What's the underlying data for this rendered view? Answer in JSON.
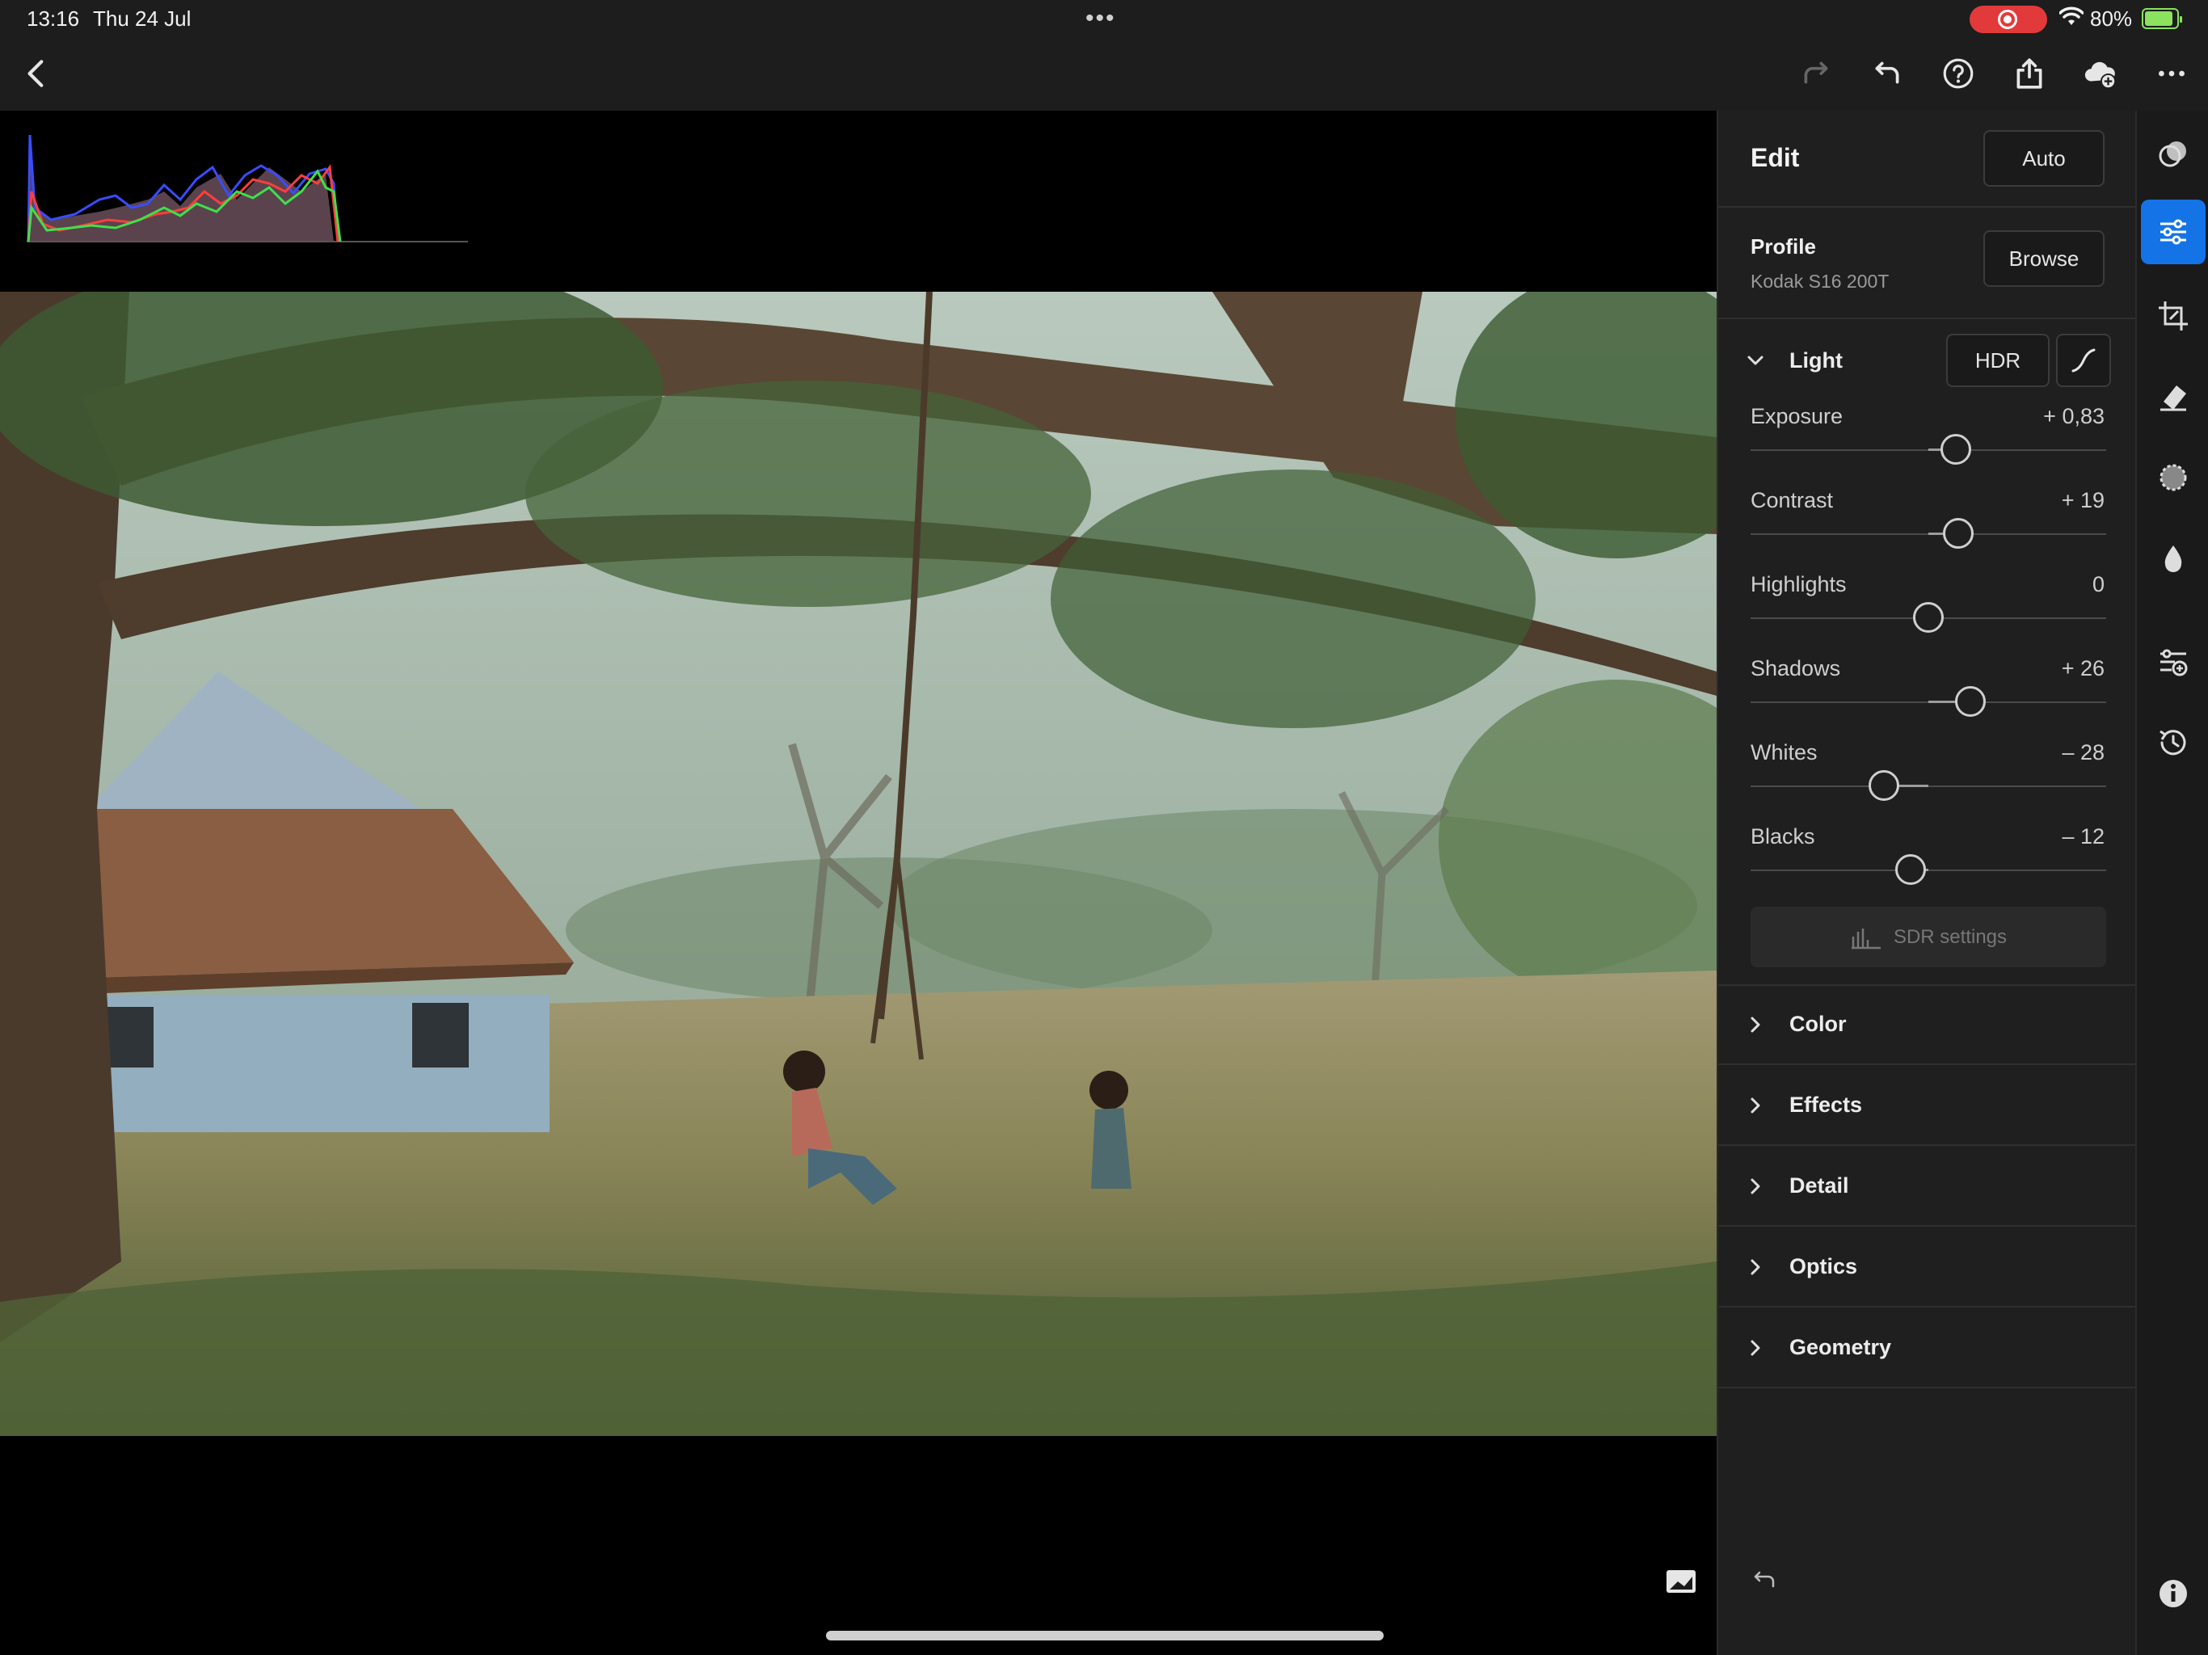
{
  "status_bar": {
    "time": "13:16",
    "date": "Thu 24 Jul",
    "battery": "80%",
    "center_dots": "•••"
  },
  "toolbar": {
    "icons": [
      "back-icon",
      "redo-icon",
      "undo-icon",
      "help-icon",
      "share-icon",
      "cloud-add-icon",
      "more-icon"
    ]
  },
  "panel": {
    "title": "Edit",
    "auto_label": "Auto",
    "profile": {
      "label": "Profile",
      "value": "Kodak S16 200T",
      "browse_label": "Browse"
    },
    "light": {
      "label": "Light",
      "hdr_label": "HDR",
      "sliders": [
        {
          "label": "Exposure",
          "value": "+ 0,83",
          "level": 0.578
        },
        {
          "label": "Contrast",
          "value": "+ 19",
          "level": 0.584
        },
        {
          "label": "Highlights",
          "value": "0",
          "level": 0.5
        },
        {
          "label": "Shadows",
          "value": "+ 26",
          "level": 0.618
        },
        {
          "label": "Whites",
          "value": "– 28",
          "level": 0.374
        },
        {
          "label": "Blacks",
          "value": "– 12",
          "level": 0.45
        }
      ],
      "sdr_label": "SDR settings"
    },
    "sections": [
      {
        "label": "Color"
      },
      {
        "label": "Effects"
      },
      {
        "label": "Detail"
      },
      {
        "label": "Optics"
      },
      {
        "label": "Geometry"
      }
    ]
  },
  "rail": {
    "icons": [
      "presets-icon",
      "edit-sliders-icon",
      "crop-icon",
      "healing-icon",
      "masking-icon",
      "blur-icon",
      "versions-icon",
      "history-icon"
    ],
    "active": "edit-sliders-icon"
  },
  "colors": {
    "accent": "#1473e6",
    "panel_bg": "#1f1f1f",
    "toolbar_bg": "#1d1d1d",
    "record_red": "#e23a3a",
    "battery_green": "#8be25e"
  }
}
